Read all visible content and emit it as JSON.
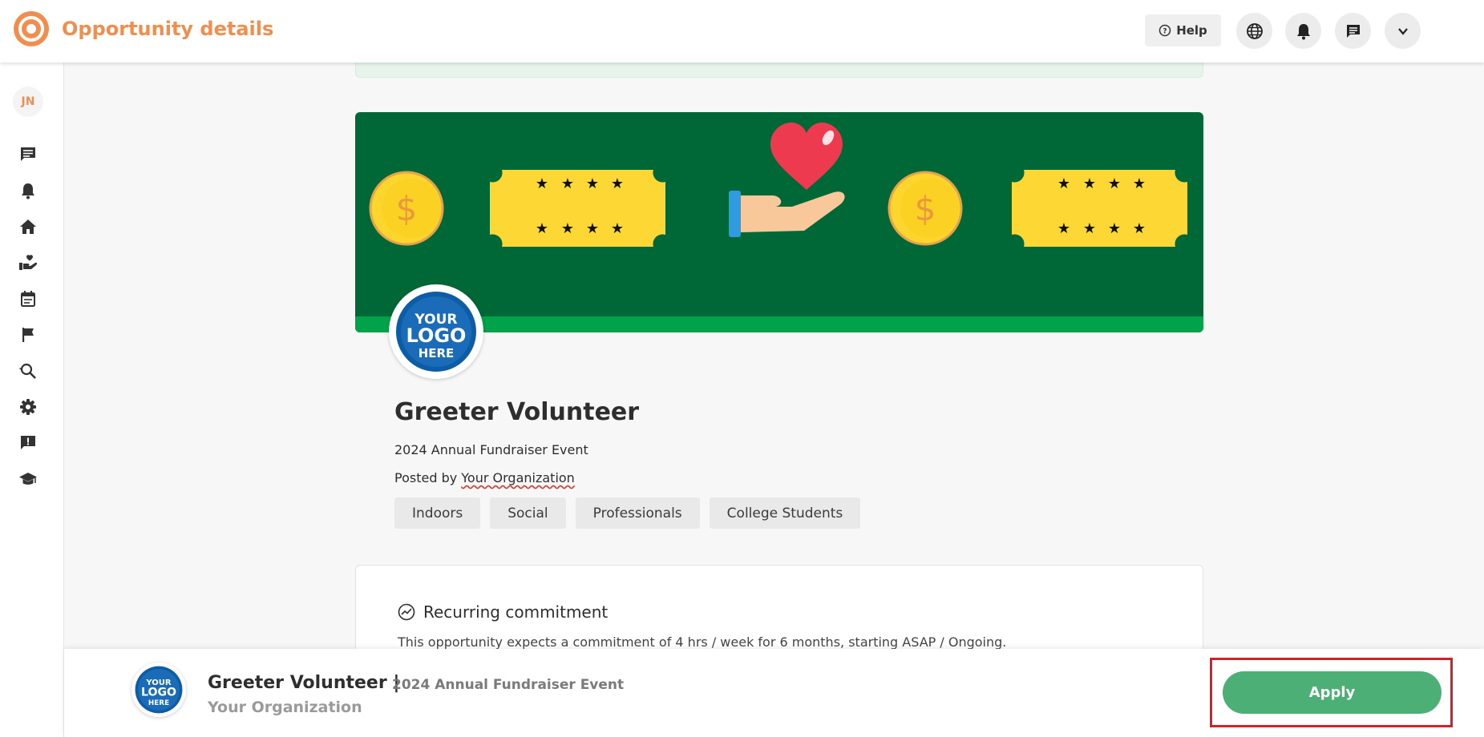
{
  "header": {
    "title": "Opportunity details",
    "help_label": "Help"
  },
  "sidebar": {
    "avatar_initials": "JN",
    "icons": [
      "chat-icon",
      "bell-icon",
      "home-icon",
      "volunteer-hand-icon",
      "calendar-icon",
      "flag-icon",
      "search-refresh-icon",
      "gear-icon",
      "feedback-icon",
      "graduation-cap-icon"
    ]
  },
  "opportunity": {
    "title": "Greeter Volunteer",
    "event": "2024 Annual Fundraiser Event",
    "posted_by_prefix": "Posted by",
    "organization": "Your Organization",
    "tags": [
      "Indoors",
      "Social",
      "Professionals",
      "College Students"
    ],
    "logo_lines": [
      "YOUR",
      "LOGO",
      "HERE"
    ]
  },
  "commitment": {
    "title": "Recurring commitment",
    "text": "This opportunity expects a commitment of 4 hrs / week for 6 months, starting ASAP / Ongoing."
  },
  "bottom_bar": {
    "title": "Greeter Volunteer |",
    "event": "2024 Annual Fundraiser Event",
    "organization": "Your Organization",
    "apply_label": "Apply"
  },
  "colors": {
    "brand_orange": "#f08e4f",
    "banner_green": "#006837",
    "banner_green_light": "#00a34a",
    "apply_green": "#4caf76",
    "highlight_red": "#d71f2a"
  }
}
